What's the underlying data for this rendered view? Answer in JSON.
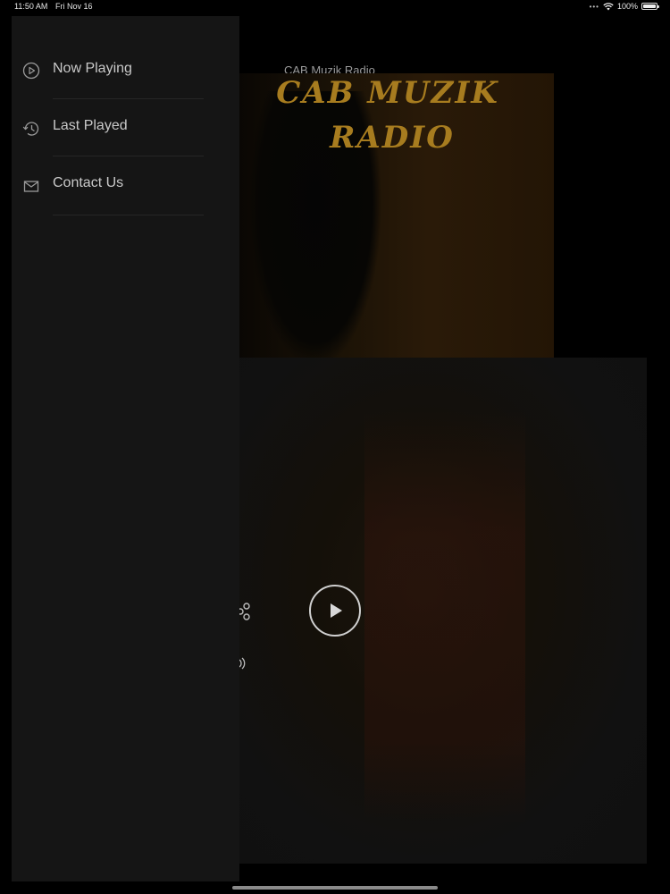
{
  "status_bar": {
    "time": "11:50 AM",
    "date": "Fri Nov 16",
    "battery": "100%",
    "icons": [
      "multitasking-dots-icon",
      "wifi-icon",
      "battery-icon"
    ]
  },
  "main": {
    "station_title": "CAB Muzik Radio",
    "logo_line_1": "CAB MUZIK",
    "logo_line_2": "RADIO",
    "accent_color": "#a77c1f",
    "controls": [
      "share-icon",
      "play-icon",
      "volume-icon"
    ]
  },
  "drawer": {
    "items": [
      {
        "label": "Now Playing",
        "icon": "play-circle-icon"
      },
      {
        "label": "Last Played",
        "icon": "history-icon"
      },
      {
        "label": "Contact Us",
        "icon": "mail-icon"
      }
    ]
  }
}
